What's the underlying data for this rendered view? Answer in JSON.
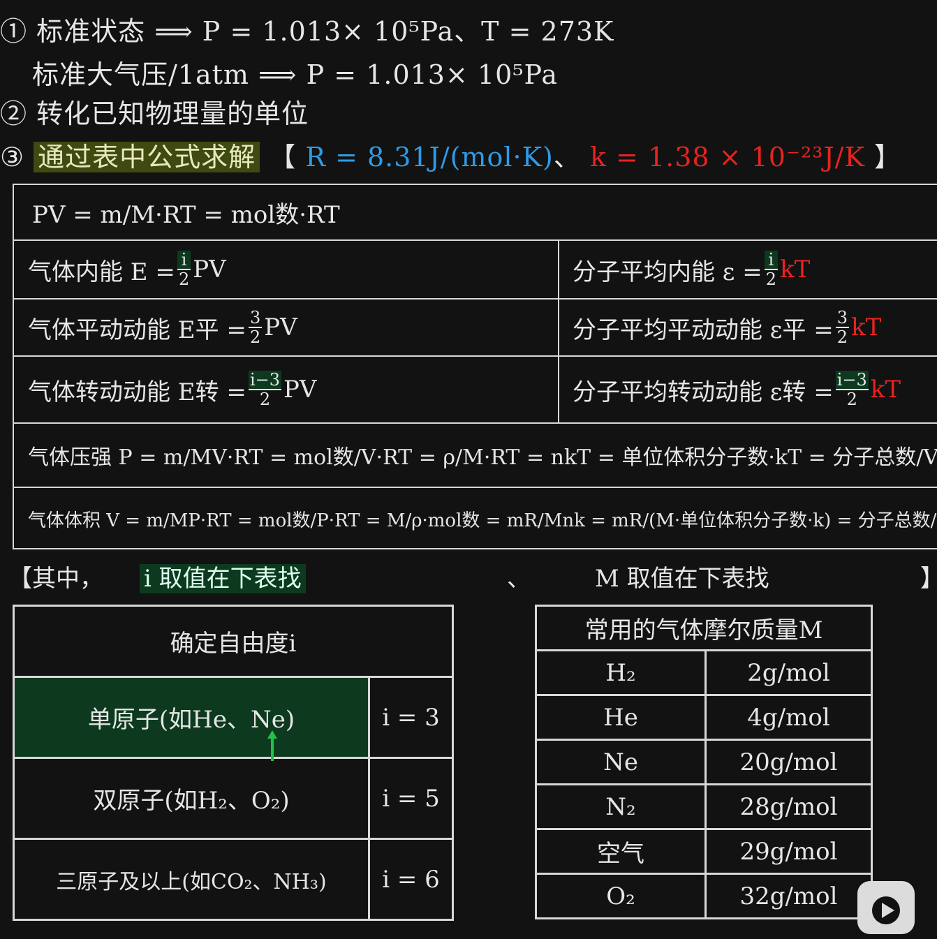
{
  "lines": {
    "l1_marker": "①",
    "l1_text": "标准状态",
    "l1_formula": "P = 1.013× 10⁵Pa、T = 273K",
    "l2_text": "标准大气压/1atm",
    "l2_formula": "P = 1.013× 10⁵Pa",
    "l3_marker": "②",
    "l3_text": "转化已知物理量的单位",
    "l4_marker": "③",
    "l4_text": "通过表中公式求解",
    "l4_bracket_open": "【",
    "l4_R": "R = 8.31J/(mol·K)",
    "l4_sep": "、",
    "l4_k": "k = 1.38 × 10⁻²³J/K",
    "l4_bracket_close": "】",
    "arrow": "⟹"
  },
  "formulas": {
    "row1": "PV = m/M·RT = mol数·RT",
    "internal_energy_label": "气体内能 E =",
    "internal_energy_tail": "PV",
    "mol_internal_label": "分子平均内能 ε =",
    "mol_internal_tail": "kT",
    "trans_label": "气体平动动能 E平 =",
    "trans_tail": "PV",
    "mol_trans_label": "分子平均平动动能 ε平 =",
    "mol_trans_tail": "kT",
    "rot_label": "气体转动动能 E转 =",
    "rot_tail": "PV",
    "mol_rot_label": "分子平均转动动能 ε转 =",
    "mol_rot_tail": "kT",
    "pressure": "气体压强 P = m/MV·RT = mol数/V·RT = ρ/M·RT = nkT = 单位体积分子数·kT = 分子总数/V·kT",
    "volume": "气体体积 V = m/MP·RT = mol数/P·RT = M/ρ·mol数 = mR/Mnk = mR/(M·单位体积分子数·k) = 分子总数/P·kT"
  },
  "note": {
    "open": "【其中，",
    "i_hint": "i 取值在下表找",
    "sep": "、",
    "m_hint": "M 取值在下表找",
    "close": "】"
  },
  "dof_table": {
    "title": "确定自由度i",
    "rows": [
      {
        "label": "单原子(如He、Ne)",
        "value": "i = 3"
      },
      {
        "label": "双原子(如H₂、O₂)",
        "value": "i = 5"
      },
      {
        "label": "三原子及以上(如CO₂、NH₃)",
        "value": "i = 6"
      }
    ]
  },
  "molar_table": {
    "title": "常用的气体摩尔质量M",
    "rows": [
      {
        "gas": "H₂",
        "mass": "2g/mol"
      },
      {
        "gas": "He",
        "mass": "4g/mol"
      },
      {
        "gas": "Ne",
        "mass": "20g/mol"
      },
      {
        "gas": "N₂",
        "mass": "28g/mol"
      },
      {
        "gas": "空气",
        "mass": "29g/mol"
      },
      {
        "gas": "O₂",
        "mass": "32g/mol"
      }
    ]
  },
  "colors": {
    "blue": "#2f9be6",
    "red": "#e8231f",
    "highlight_green": "#0d3a1f",
    "highlight_yellow": "#3f4a10"
  }
}
